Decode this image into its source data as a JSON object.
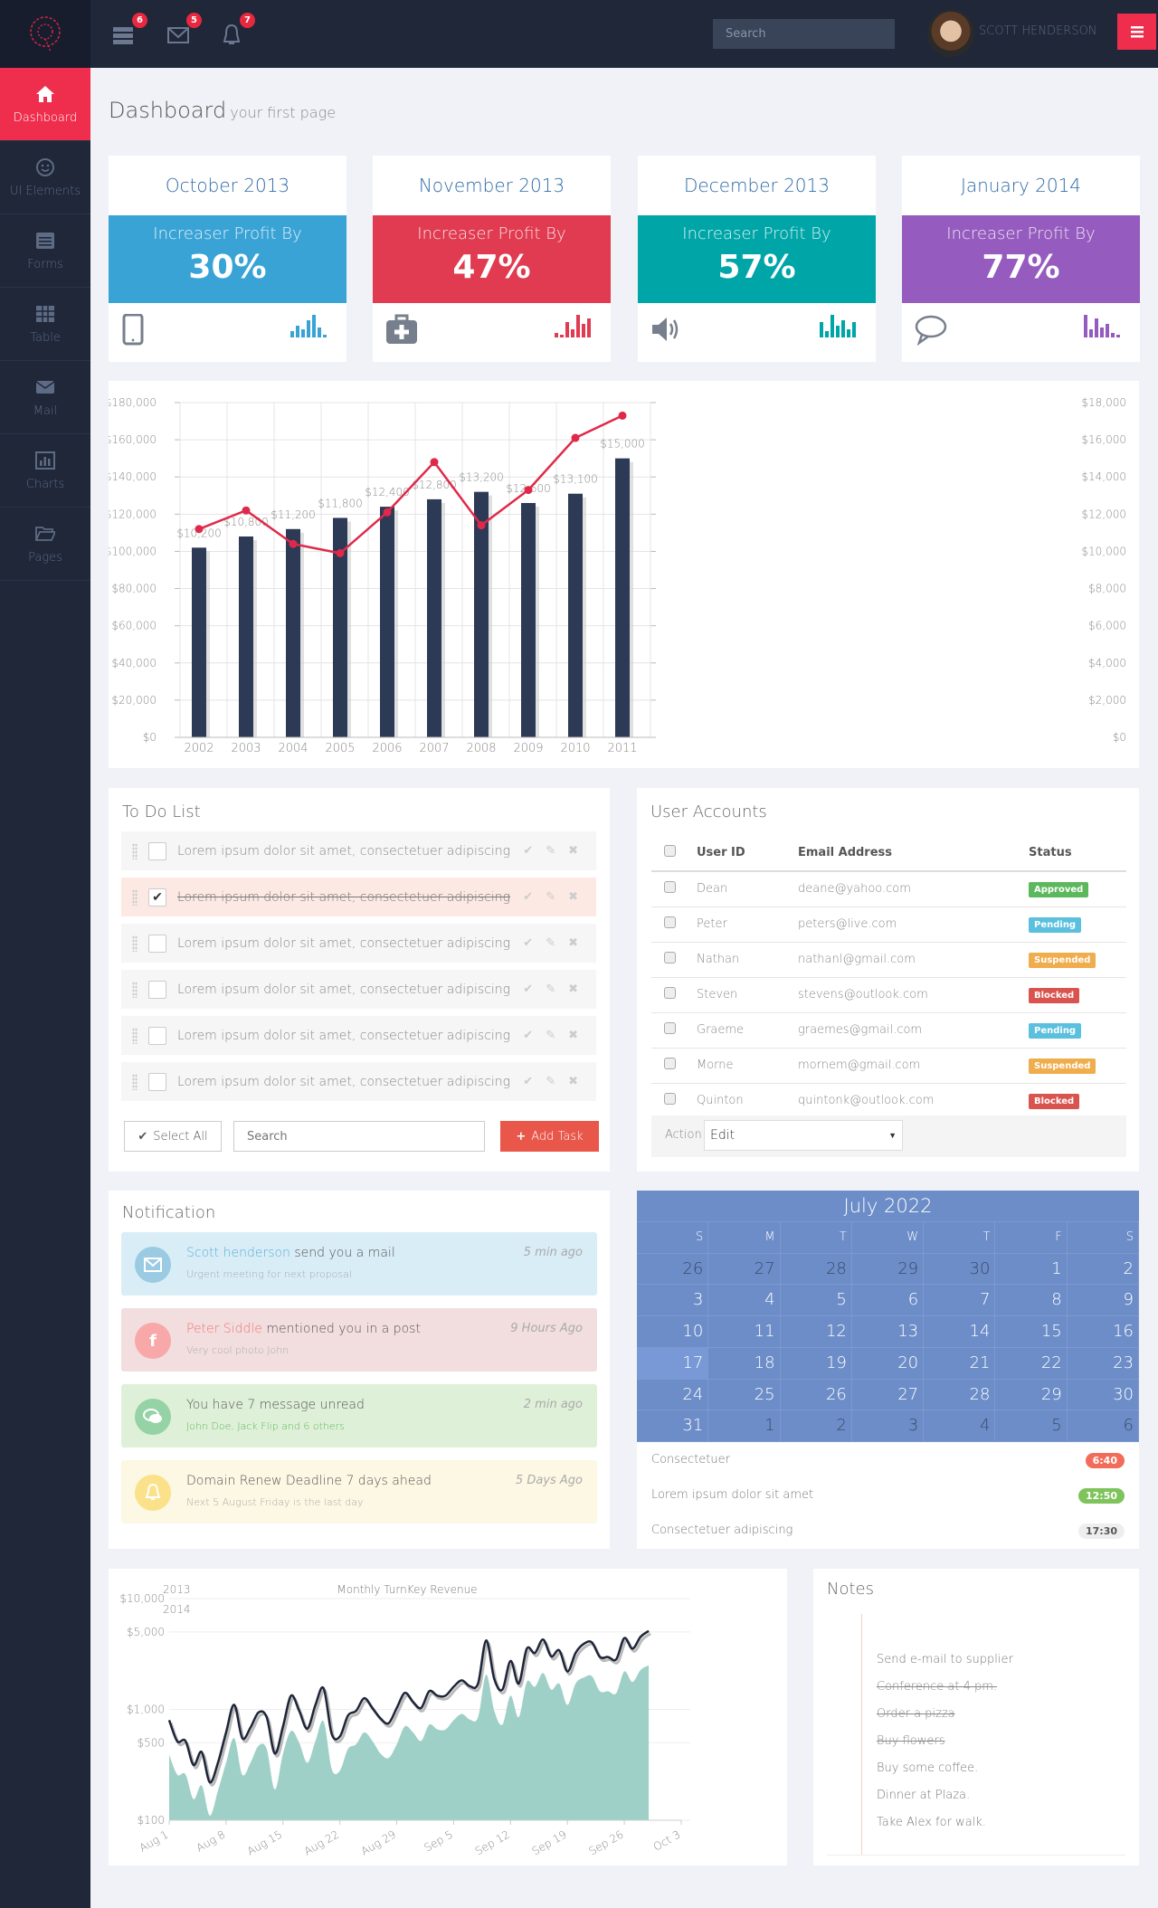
{
  "header": {
    "badges": {
      "tasks": "6",
      "mail": "5",
      "notifications": "7"
    },
    "search_placeholder": "Search",
    "user_name": "SCOTT HENDERSON"
  },
  "sidebar": {
    "items": [
      {
        "label": "Dashboard",
        "icon": "home-icon",
        "active": true
      },
      {
        "label": "UI Elements",
        "icon": "smiley-icon"
      },
      {
        "label": "Forms",
        "icon": "form-icon"
      },
      {
        "label": "Table",
        "icon": "table-icon"
      },
      {
        "label": "Mail",
        "icon": "mail-icon"
      },
      {
        "label": "Charts",
        "icon": "bar-chart-icon"
      },
      {
        "label": "Pages",
        "icon": "folder-icon"
      }
    ]
  },
  "page": {
    "title": "Dashboard",
    "subtitle": "your first page"
  },
  "stats": [
    {
      "month": "October 2013",
      "label": "Increaser Profit By",
      "value": "30%",
      "color": "#3aa3d6",
      "icon": "tablet-icon"
    },
    {
      "month": "November 2013",
      "label": "Increaser Profit By",
      "value": "47%",
      "color": "#e03b50",
      "icon": "medkit-icon"
    },
    {
      "month": "December 2013",
      "label": "Increaser Profit By",
      "value": "57%",
      "color": "#00a5a8",
      "icon": "volume-icon"
    },
    {
      "month": "January 2014",
      "label": "Increaser Profit By",
      "value": "77%",
      "color": "#955bbe",
      "icon": "comment-icon"
    }
  ],
  "chart_data": [
    {
      "type": "bar+line",
      "categories": [
        "2002",
        "2003",
        "2004",
        "2005",
        "2006",
        "2007",
        "2008",
        "2009",
        "2010",
        "2011"
      ],
      "bars": {
        "axis": "right",
        "values": [
          10200,
          10800,
          11200,
          11800,
          12400,
          12800,
          13200,
          12600,
          13100,
          15000
        ],
        "labels": [
          "$10,200",
          "$10,800",
          "$11,200",
          "$11,800",
          "$12,400",
          "$12,800",
          "$13,200",
          "$12,600",
          "$13,100",
          "$15,000"
        ],
        "color": "#2c3a55"
      },
      "line": {
        "axis": "left",
        "values": [
          112000,
          122000,
          104000,
          99000,
          121000,
          148000,
          114000,
          133000,
          161000,
          173000
        ],
        "color": "#e0294a"
      },
      "left_axis": {
        "range": [
          0,
          180000
        ],
        "ticks": [
          "$0",
          "$20,000",
          "$40,000",
          "$60,000",
          "$80,000",
          "$100,000",
          "$120,000",
          "$140,000",
          "$160,000",
          "$180,000"
        ]
      },
      "right_axis": {
        "range": [
          0,
          18000
        ],
        "ticks": [
          "$0",
          "$2,000",
          "$4,000",
          "$6,000",
          "$8,000",
          "$10,000",
          "$12,000",
          "$14,000",
          "$16,000",
          "$18,000"
        ]
      },
      "grid": true
    },
    {
      "type": "area+line",
      "title": "Monthly TurnKey Revenue",
      "y_scale": "log",
      "ylim": [
        100,
        10000
      ],
      "y_ticks": [
        "$100",
        "$500",
        "$1,000",
        "$5,000",
        "$10,000"
      ],
      "y_tick_values": [
        100,
        500,
        1000,
        5000,
        10000
      ],
      "x_start": "Aug 1",
      "x_ticks": [
        "Aug 1",
        "Aug 8",
        "Aug 15",
        "Aug 22",
        "Aug 29",
        "Sep 5",
        "Sep 12",
        "Sep 19",
        "Sep 26",
        "Oct 3"
      ],
      "legend": [
        "2013",
        "2014"
      ],
      "series": [
        {
          "name": "2013",
          "type": "area",
          "color": "#9fd0c7",
          "values": [
            390,
            258,
            260,
            155,
            206,
            110,
            185,
            330,
            550,
            258,
            330,
            470,
            440,
            190,
            400,
            640,
            500,
            330,
            520,
            780,
            290,
            280,
            440,
            485,
            620,
            520,
            400,
            365,
            485,
            705,
            620,
            520,
            730,
            660,
            660,
            800,
            910,
            810,
            850,
            2060,
            970,
            730,
            1330,
            850,
            1770,
            1600,
            2130,
            1510,
            1710,
            1100,
            1710,
            1940,
            2000,
            1460,
            1460,
            1400,
            2200,
            1770,
            2270,
            2500
          ]
        },
        {
          "name": "2014",
          "type": "line",
          "color": "#1d2538",
          "values": [
            800,
            515,
            520,
            315,
            413,
            220,
            330,
            620,
            1100,
            550,
            685,
            940,
            850,
            400,
            700,
            1330,
            970,
            670,
            1100,
            1550,
            600,
            570,
            880,
            970,
            1260,
            1030,
            830,
            750,
            1030,
            1410,
            1170,
            1030,
            1460,
            1330,
            1330,
            1600,
            1830,
            1620,
            1710,
            4190,
            1880,
            1510,
            2740,
            1710,
            3530,
            3230,
            4270,
            3010,
            3410,
            2200,
            3230,
            3900,
            4030,
            2970,
            2970,
            2830,
            4400,
            3530,
            4520,
            5100
          ]
        }
      ]
    }
  ],
  "todo": {
    "title": "To Do List",
    "items": [
      {
        "text": "Lorem ipsum dolor sit amet, consectetuer adipiscing",
        "done": false
      },
      {
        "text": "Lorem ipsum dolor sit amet, consectetuer adipiscing",
        "done": true
      },
      {
        "text": "Lorem ipsum dolor sit amet, consectetuer adipiscing",
        "done": false
      },
      {
        "text": "Lorem ipsum dolor sit amet, consectetuer adipiscing",
        "done": false
      },
      {
        "text": "Lorem ipsum dolor sit amet, consectetuer adipiscing",
        "done": false
      },
      {
        "text": "Lorem ipsum dolor sit amet, consectetuer adipiscing",
        "done": false
      }
    ],
    "select_all": "Select All",
    "search_placeholder": "Search",
    "add_task": "Add Task"
  },
  "accounts": {
    "title": "User Accounts",
    "columns": [
      "User ID",
      "Email Address",
      "Status"
    ],
    "rows": [
      {
        "id": "Dean",
        "email": "deane@yahoo.com",
        "status": "Approved",
        "color": "#5cb85c"
      },
      {
        "id": "Peter",
        "email": "peters@live.com",
        "status": "Pending",
        "color": "#5bc0de"
      },
      {
        "id": "Nathan",
        "email": "nathanl@gmail.com",
        "status": "Suspended",
        "color": "#f0ad4e"
      },
      {
        "id": "Steven",
        "email": "stevens@outlook.com",
        "status": "Blocked",
        "color": "#d9534f"
      },
      {
        "id": "Graeme",
        "email": "graemes@gmail.com",
        "status": "Pending",
        "color": "#5bc0de"
      },
      {
        "id": "Morne",
        "email": "mornem@gmail.com",
        "status": "Suspended",
        "color": "#f0ad4e"
      },
      {
        "id": "Quinton",
        "email": "quintonk@outlook.com",
        "status": "Blocked",
        "color": "#d9534f"
      }
    ],
    "action_label": "Action",
    "action_value": "Edit"
  },
  "notifications": {
    "title": "Notification",
    "items": [
      {
        "who": "Scott henderson",
        "text": " send you a mail",
        "sub": "Urgent meeting for next proposal",
        "time": "5 min ago",
        "bg": "#d9edf7",
        "ic": "#9acbe3",
        "accent": "#5aaed8",
        "icon": "envelope-icon"
      },
      {
        "who": "Peter Siddle",
        "text": " mentioned you in a post",
        "sub": "Very cool photo John",
        "time": "9 Hours Ago",
        "bg": "#f2dede",
        "ic": "#f8a8a8",
        "accent": "#ee7777",
        "icon": "facebook-icon"
      },
      {
        "who": "",
        "text": "You have 7 message unread",
        "sub": "John Doe, Jack Flip and 6 others",
        "time": "2 min ago",
        "bg": "#dff0d8",
        "ic": "#95d2a6",
        "accent": "#5cb85c",
        "icon": "chat-icon"
      },
      {
        "who": "",
        "text": "Domain Renew Deadline 7 days ahead",
        "sub": "Next 5 August Friday is the last day",
        "time": "5 Days Ago",
        "bg": "#fcf8e3",
        "ic": "#fbe18a",
        "accent": "#f0ad4e",
        "icon": "bell-icon"
      }
    ]
  },
  "calendar": {
    "title": "July 2022",
    "weekdays": [
      "S",
      "M",
      "T",
      "W",
      "T",
      "F",
      "S"
    ],
    "days": [
      "26",
      "27",
      "28",
      "29",
      "30",
      "1",
      "2",
      "3",
      "4",
      "5",
      "6",
      "7",
      "8",
      "9",
      "10",
      "11",
      "12",
      "13",
      "14",
      "15",
      "16",
      "17",
      "18",
      "19",
      "20",
      "21",
      "22",
      "23",
      "24",
      "25",
      "26",
      "27",
      "28",
      "29",
      "30",
      "31",
      "1",
      "2",
      "3",
      "4",
      "5",
      "6"
    ],
    "today": "17",
    "events": [
      {
        "text": "Consectetuer",
        "time": "6:40",
        "color": "#f26c5a"
      },
      {
        "text": "Lorem ipsum dolor sit amet",
        "time": "12:50",
        "color": "#7ec35b"
      },
      {
        "text": "Consectetuer adipiscing",
        "time": "17:30",
        "color": "#eeeeee"
      }
    ]
  },
  "notes": {
    "title": "Notes",
    "items": [
      {
        "text": "Send e-mail to supplier",
        "done": false
      },
      {
        "text": "Conference at 4 pm.",
        "done": true
      },
      {
        "text": "Order a pizza",
        "done": true
      },
      {
        "text": "Buy flowers",
        "done": true
      },
      {
        "text": "Buy some coffee.",
        "done": false
      },
      {
        "text": "Dinner at Plaza.",
        "done": false
      },
      {
        "text": "Take Alex for walk.",
        "done": false
      }
    ]
  }
}
